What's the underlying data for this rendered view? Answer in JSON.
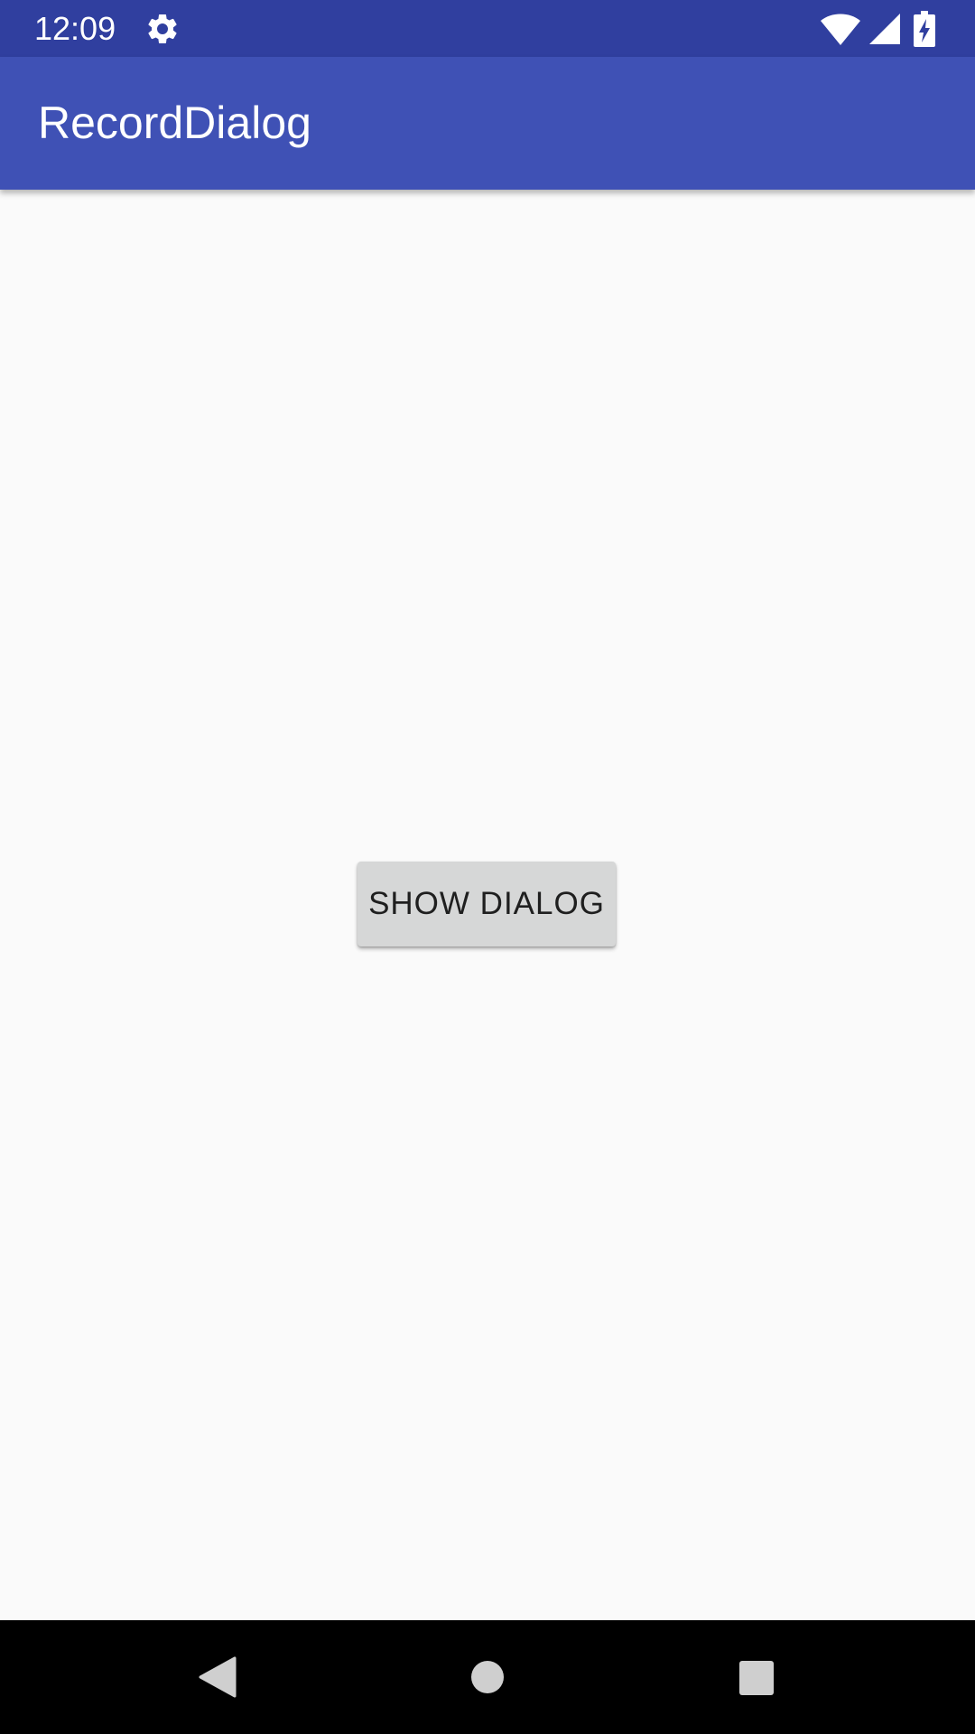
{
  "status_bar": {
    "time": "12:09",
    "icons": [
      "gear-icon",
      "wifi-icon",
      "signal-icon",
      "battery-charging-icon"
    ],
    "color": "#303f9f"
  },
  "app_bar": {
    "title": "RecordDialog",
    "color": "#3f51b5"
  },
  "main": {
    "show_dialog_label": "SHOW DIALOG"
  },
  "nav_bar": {
    "icons": [
      "back-icon",
      "home-icon",
      "recents-icon"
    ]
  }
}
